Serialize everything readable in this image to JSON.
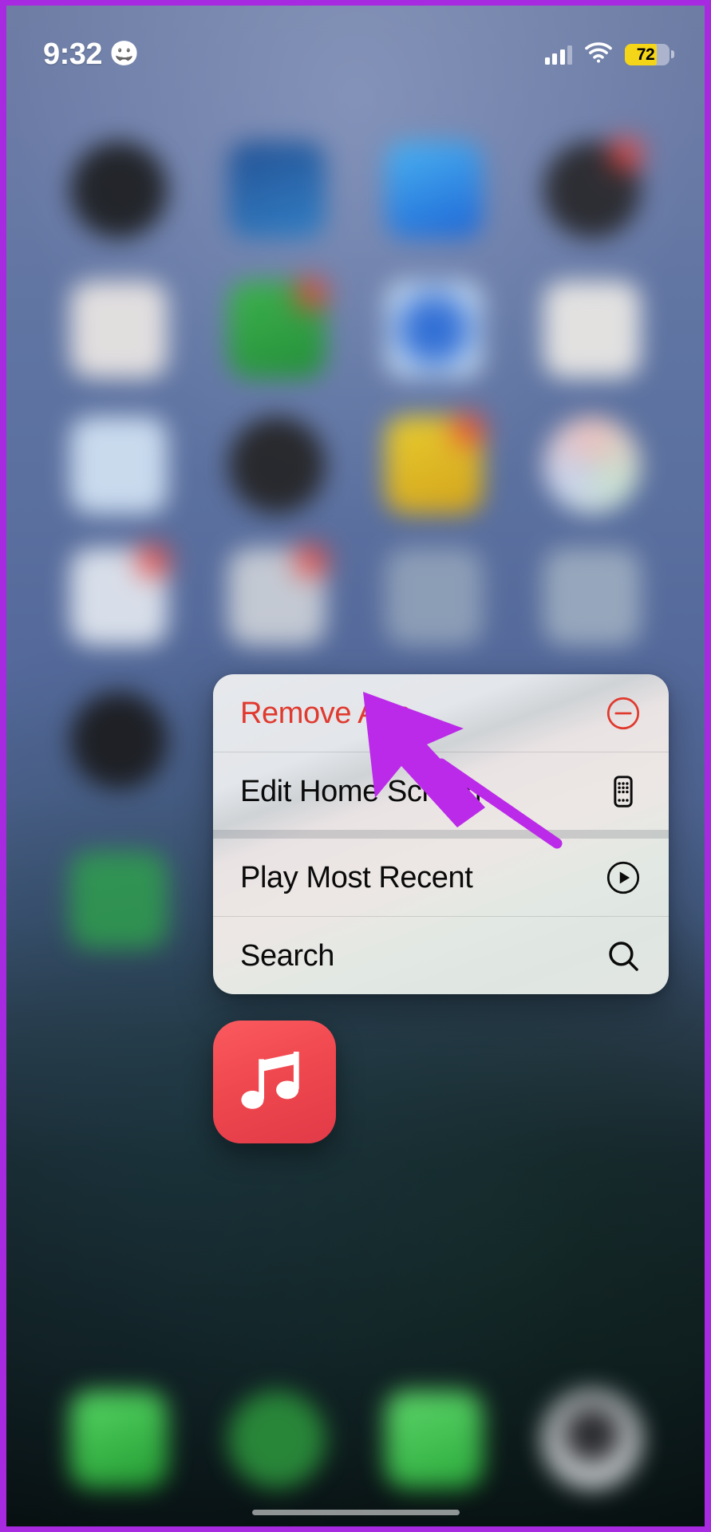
{
  "status_bar": {
    "time": "9:32",
    "focus_emoji": "😀",
    "focus_icon_name": "smiley-face-focus-icon",
    "signal_bars_filled": 3,
    "signal_bars_total": 4,
    "wifi_label": "wifi-icon",
    "battery_percent": "72",
    "battery_level": 72,
    "battery_color": "#f5d518",
    "battery_low_power_mode": true
  },
  "context_menu": {
    "items": [
      {
        "label": "Remove App",
        "icon": "minus-circle-icon",
        "destructive": true,
        "separator_after": "thin"
      },
      {
        "label": "Edit Home Screen",
        "icon": "iphone-apps-grid-icon",
        "destructive": false,
        "separator_after": "group"
      },
      {
        "label": "Play Most Recent",
        "icon": "play-circle-icon",
        "destructive": false,
        "separator_after": "thin"
      },
      {
        "label": "Search",
        "icon": "magnifier-icon",
        "destructive": false,
        "separator_after": "none"
      }
    ]
  },
  "app_icon": {
    "name": "music-app-icon",
    "glyph": "music-note-icon",
    "color": "#ef4750"
  },
  "annotation": {
    "arrow_color": "#bb2ae8",
    "arrow_target": "Remove App",
    "frame_color": "#a82ae0"
  },
  "home_screen": {
    "rows": [
      {
        "icons": [
          {
            "name": "blurred-app-1",
            "color": "#1f2124",
            "shape": "round",
            "badge": false
          },
          {
            "name": "blurred-app-2",
            "color": "#1f4f93",
            "shape": "square",
            "badge": false
          },
          {
            "name": "blurred-app-3",
            "color": "#2b8cf0",
            "shape": "square",
            "badge": false
          },
          {
            "name": "blurred-app-4",
            "color": "#2a2a2e",
            "shape": "round",
            "badge": true
          }
        ]
      },
      {
        "icons": [
          {
            "name": "blurred-app-5",
            "color": "#e8e4e2",
            "shape": "square",
            "badge": false
          },
          {
            "name": "blurred-app-6",
            "color": "#3cb54a",
            "shape": "square",
            "badge": true
          },
          {
            "name": "blurred-app-7",
            "color": "#3f7fe0",
            "shape": "square",
            "badge": false
          },
          {
            "name": "blurred-app-8",
            "color": "#e9e7e4",
            "shape": "square",
            "badge": false
          }
        ]
      },
      {
        "icons": [
          {
            "name": "blurred-app-9",
            "color": "#cfe0f2",
            "shape": "square",
            "badge": false
          },
          {
            "name": "blurred-app-10",
            "color": "#262628",
            "shape": "round",
            "badge": false
          },
          {
            "name": "blurred-app-11",
            "color": "#e8c21e",
            "shape": "square",
            "badge": true
          },
          {
            "name": "blurred-app-12",
            "color": "#ece9e5",
            "shape": "round",
            "badge": false
          }
        ]
      },
      {
        "icons": [
          {
            "name": "blurred-app-13",
            "color": "#dfe5ee",
            "shape": "square",
            "badge": true
          },
          {
            "name": "blurred-app-14",
            "color": "#c9ced6",
            "shape": "square",
            "badge": true
          },
          {
            "name": "blurred-app-15",
            "color": "#8fa0b8",
            "shape": "square",
            "badge": false
          },
          {
            "name": "blurred-app-16",
            "color": "#9aaabe",
            "shape": "square",
            "badge": false
          }
        ]
      }
    ],
    "dock": [
      {
        "name": "dock-app-1",
        "color": "#3ccf49",
        "shape": "square"
      },
      {
        "name": "dock-app-2",
        "color": "#2a8c3a",
        "shape": "round"
      },
      {
        "name": "dock-app-3",
        "color": "#44cf55",
        "shape": "square"
      },
      {
        "name": "dock-app-4",
        "color": "#e4e8ea",
        "shape": "round"
      }
    ]
  }
}
